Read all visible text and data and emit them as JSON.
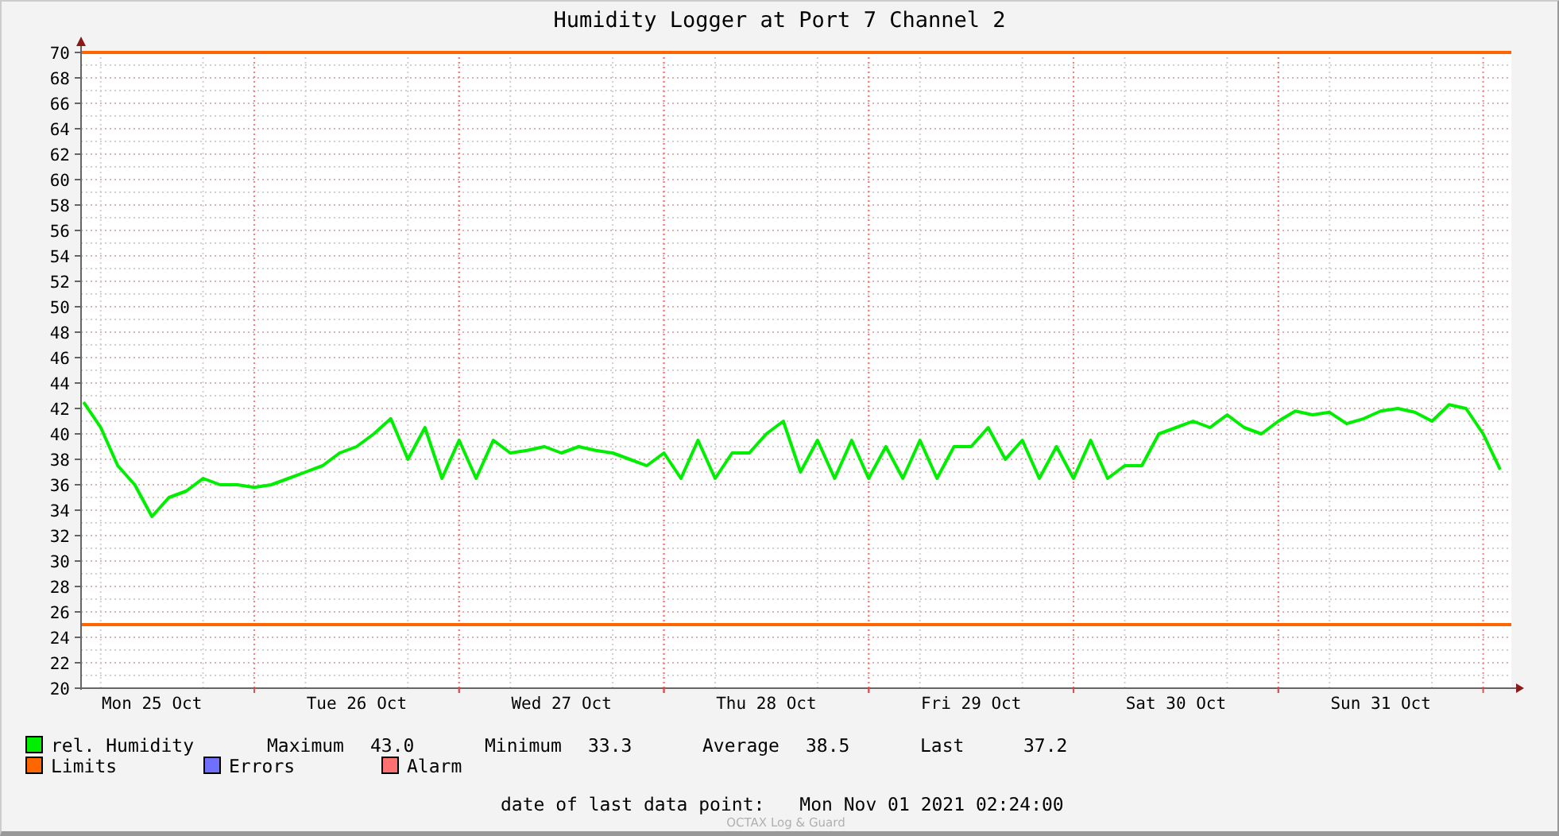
{
  "chart": {
    "chart_data": {
      "type": "line",
      "title": "Humidity Logger at Port 7 Channel 2",
      "categories": [
        null,
        null,
        null,
        null,
        "Mon 25 Oct",
        null,
        null,
        null,
        null,
        null,
        null,
        null,
        null,
        null,
        null,
        null,
        "Tue 26 Oct",
        null,
        null,
        null,
        null,
        null,
        null,
        null,
        null,
        null,
        null,
        null,
        "Wed 27 Oct",
        null,
        null,
        null,
        null,
        null,
        null,
        null,
        null,
        null,
        null,
        null,
        "Thu 28 Oct",
        null,
        null,
        null,
        null,
        null,
        null,
        null,
        null,
        null,
        null,
        null,
        "Fri 29 Oct",
        null,
        null,
        null,
        null,
        null,
        null,
        null,
        null,
        null,
        null,
        null,
        "Sat 30 Oct",
        null,
        null,
        null,
        null,
        null,
        null,
        null,
        null,
        null,
        null,
        null,
        "Sun 31 Oct",
        null,
        null,
        null,
        null,
        null,
        null,
        null
      ],
      "series": [
        {
          "name": "rel. Humidity",
          "color": "#00ee00",
          "values": [
            42.5,
            40.5,
            37.5,
            36,
            33.5,
            35,
            35.5,
            36.5,
            36,
            36,
            35.8,
            36,
            36.5,
            37,
            37.5,
            38.5,
            39,
            40,
            41.2,
            38,
            40.5,
            36.5,
            39.5,
            36.5,
            39.5,
            38.5,
            38.7,
            39,
            38.5,
            39,
            38.7,
            38.5,
            38,
            37.5,
            38.5,
            36.5,
            39.5,
            36.5,
            38.5,
            38.5,
            40,
            41,
            37,
            39.5,
            36.5,
            39.5,
            36.5,
            39,
            36.5,
            39.5,
            36.5,
            39,
            39,
            40.5,
            38,
            39.5,
            36.5,
            39,
            36.5,
            39.5,
            36.5,
            37.5,
            37.5,
            40,
            40.5,
            41,
            40.5,
            41.5,
            40.5,
            40,
            41,
            41.8,
            41.5,
            41.7,
            40.8,
            41.2,
            41.8,
            42,
            41.7,
            41,
            42.3,
            42,
            40,
            37.2
          ]
        }
      ],
      "ylim": [
        20,
        70
      ],
      "yticks": [
        20,
        22,
        24,
        26,
        28,
        30,
        32,
        34,
        36,
        38,
        40,
        42,
        44,
        46,
        48,
        50,
        52,
        54,
        56,
        58,
        60,
        62,
        64,
        66,
        68,
        70
      ],
      "grid": true,
      "ref_lines": [
        {
          "axis": "y",
          "value": 70
        },
        {
          "axis": "y",
          "value": 25
        }
      ]
    }
  },
  "legend": [
    {
      "label": "Limits",
      "color": "#ff6600"
    },
    {
      "label": "Errors",
      "color": "#7070ff"
    },
    {
      "label": "Alarm",
      "color": "#ff7070"
    }
  ],
  "stats": [
    {
      "label": "Maximum",
      "value": "43.0"
    },
    {
      "label": "Minimum",
      "value": "33.3"
    },
    {
      "label": "Average",
      "value": "38.5"
    },
    {
      "label": "Last",
      "value": "37.2"
    }
  ],
  "last_data_point": {
    "label": "date of last data point:",
    "value": "Mon Nov 01 2021 02:24:00"
  },
  "credit": "OCTAX Log & Guard"
}
